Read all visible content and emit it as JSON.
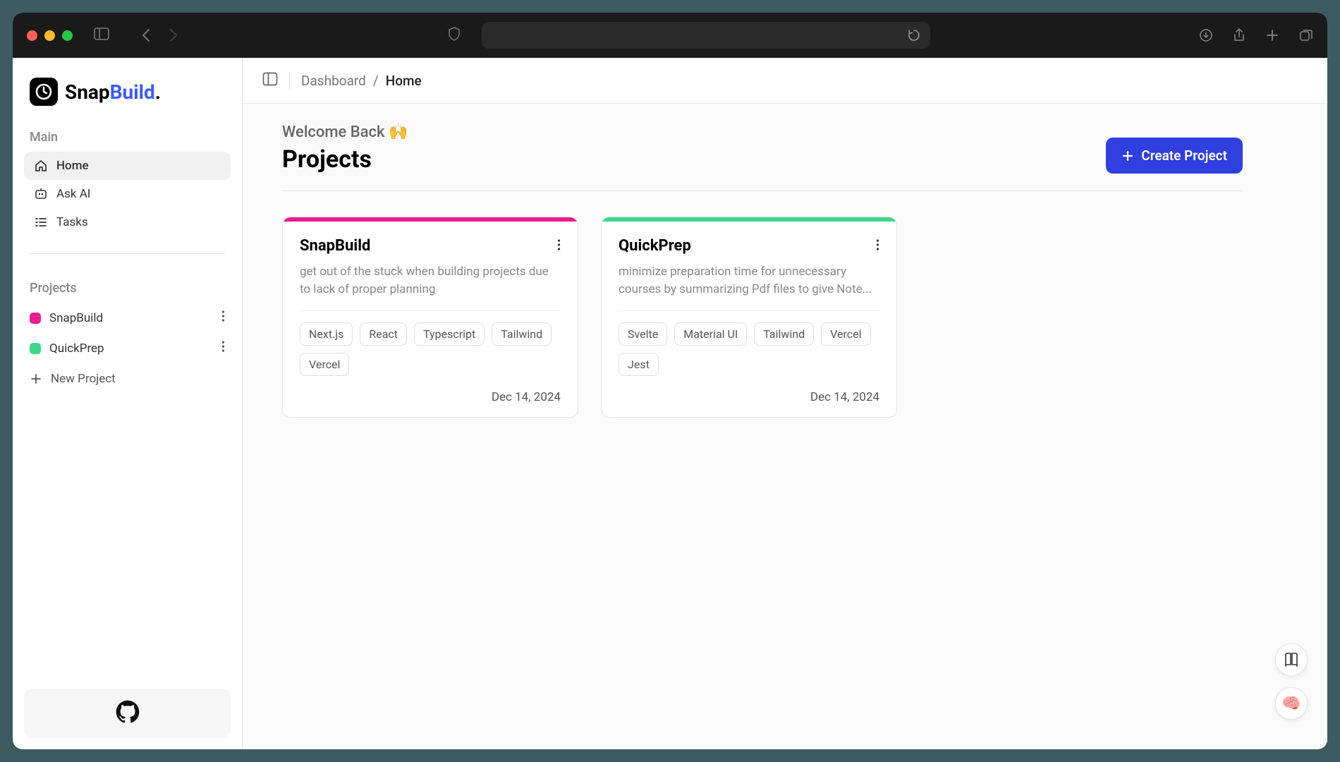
{
  "logo": {
    "name": "Snap",
    "name_accent": "Build",
    "suffix": "."
  },
  "sidebar": {
    "main_label": "Main",
    "items": [
      {
        "label": "Home",
        "icon": "home"
      },
      {
        "label": "Ask AI",
        "icon": "sparkle"
      },
      {
        "label": "Tasks",
        "icon": "tasks"
      }
    ],
    "projects_label": "Projects",
    "projects": [
      {
        "label": "SnapBuild",
        "color": "#ec1b8e"
      },
      {
        "label": "QuickPrep",
        "color": "#3dd68c"
      }
    ],
    "new_project_label": "New Project"
  },
  "breadcrumb": {
    "root": "Dashboard",
    "sep": "/",
    "current": "Home"
  },
  "header": {
    "welcome": "Welcome Back 🙌",
    "title": "Projects",
    "create_label": "Create Project"
  },
  "cards": [
    {
      "title": "SnapBuild",
      "stripe": "#ec1b8e",
      "desc": "get out of the stuck when building projects due to lack of proper planning",
      "tags": [
        "Next.js",
        "React",
        "Typescript",
        "Tailwind",
        "Vercel"
      ],
      "date": "Dec 14, 2024"
    },
    {
      "title": "QuickPrep",
      "stripe": "#3dd68c",
      "desc": "minimize preparation time for unnecessary courses by summarizing Pdf files to give Note...",
      "tags": [
        "Svelte",
        "Material UI",
        "Tailwind",
        "Vercel",
        "Jest"
      ],
      "date": "Dec 14, 2024"
    }
  ]
}
